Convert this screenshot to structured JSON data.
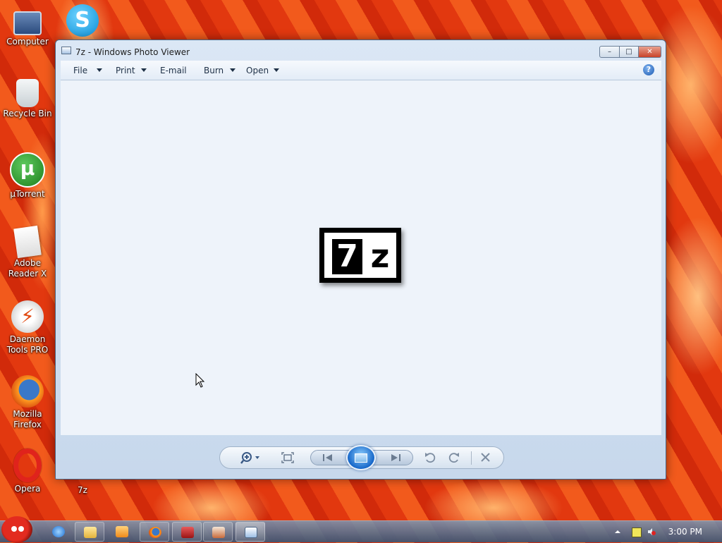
{
  "desktop": {
    "icons": [
      {
        "label": "Computer",
        "icon": "computer-icon"
      },
      {
        "label": "",
        "icon": "skype-icon"
      },
      {
        "label": "Recycle Bin",
        "icon": "recycle-bin-icon"
      },
      {
        "label": "µTorrent",
        "icon": "utorrent-icon"
      },
      {
        "label": "Adobe Reader X",
        "icon": "adobe-reader-icon"
      },
      {
        "label": "Daemon Tools PRO",
        "icon": "daemon-tools-icon"
      },
      {
        "label": "Mozilla Firefox",
        "icon": "firefox-icon"
      },
      {
        "label": "Opera",
        "icon": "opera-icon"
      },
      {
        "label": "7z",
        "icon": "7z-file-icon"
      }
    ],
    "background_color": "#e6420f"
  },
  "window": {
    "title": "7z - Windows Photo Viewer",
    "buttons": {
      "minimize": "–",
      "maximize": "□",
      "close": "✕"
    },
    "menu": [
      {
        "label": "File",
        "dropdown": true
      },
      {
        "label": "Print",
        "dropdown": true
      },
      {
        "label": "E-mail",
        "dropdown": false
      },
      {
        "label": "Burn",
        "dropdown": true
      },
      {
        "label": "Open",
        "dropdown": true
      }
    ],
    "help_label": "?",
    "image": {
      "logo_number": "7",
      "logo_letter": "z"
    },
    "controls": {
      "zoom_icon": "zoom-icon",
      "actual_size_icon": "fit-window-icon",
      "previous_icon": "previous-icon",
      "slideshow_icon": "slideshow-icon",
      "next_icon": "next-icon",
      "rotate_ccw_icon": "rotate-counterclockwise-icon",
      "rotate_cw_icon": "rotate-clockwise-icon",
      "delete_icon": "delete-icon"
    }
  },
  "taskbar": {
    "apps": [
      {
        "name": "angry-birds-start",
        "icon": "start-orb-icon"
      },
      {
        "name": "internet-explorer",
        "icon": "ie-icon"
      },
      {
        "name": "windows-explorer",
        "icon": "folder-icon"
      },
      {
        "name": "media-player",
        "icon": "media-player-icon"
      },
      {
        "name": "firefox",
        "icon": "firefox-icon"
      },
      {
        "name": "app-red",
        "icon": "app-icon"
      },
      {
        "name": "app-bird",
        "icon": "app-icon"
      },
      {
        "name": "photo-viewer",
        "icon": "photo-viewer-icon"
      }
    ],
    "clock": "3:00 PM"
  }
}
